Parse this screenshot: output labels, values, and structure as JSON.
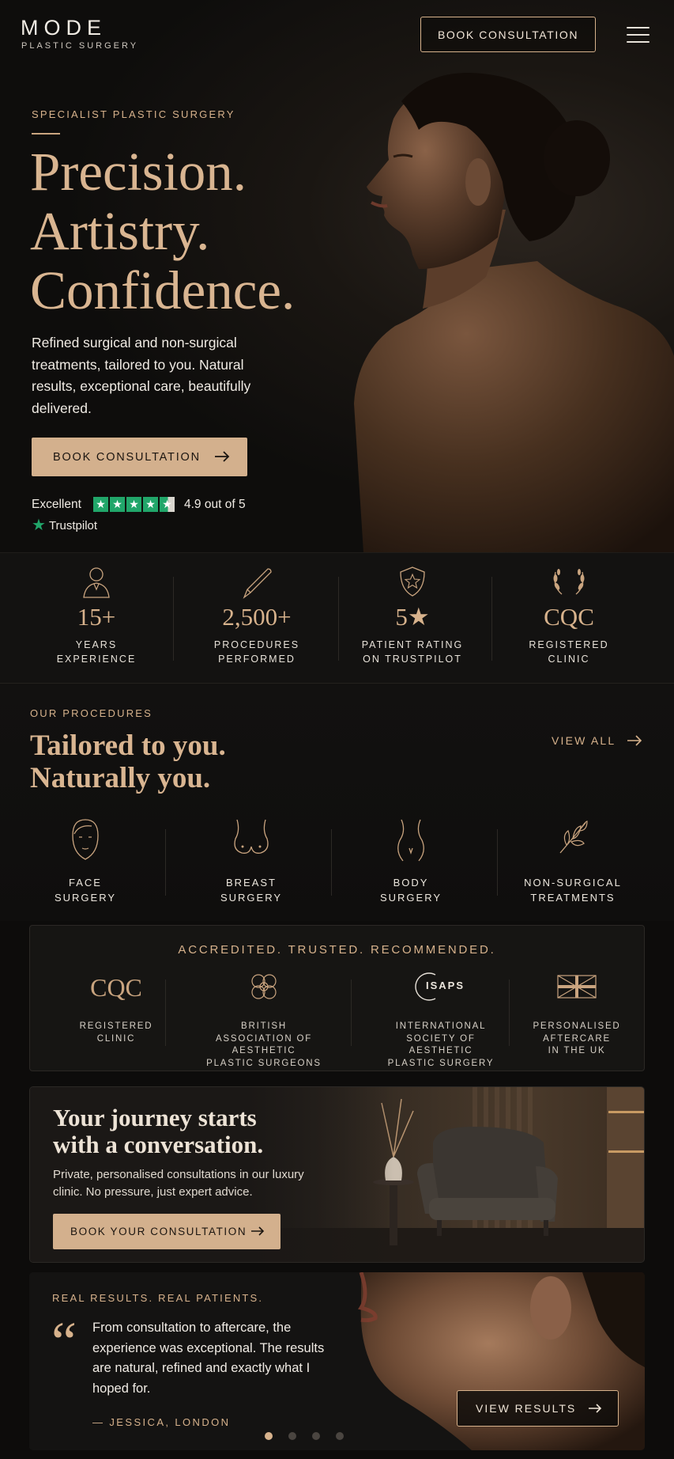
{
  "header": {
    "logo": "MODE",
    "logo_sub": "PLASTIC SURGERY",
    "cta": "BOOK CONSULTATION"
  },
  "hero": {
    "eyebrow": "SPECIALIST PLASTIC SURGERY",
    "title_lines": [
      "Precision.",
      "Artistry.",
      "Confidence."
    ],
    "description": "Refined surgical and non-surgical treatments, tailored to you. Natural results, exceptional care, beautifully delivered.",
    "cta": "BOOK CONSULTATION",
    "trustpilot": {
      "label": "Excellent",
      "rating": 4.9,
      "score_text": "4.9 out of 5",
      "brand": "Trustpilot",
      "brand_color": "#21a66a"
    }
  },
  "stats": [
    {
      "icon": "person-icon",
      "value": "15+",
      "label_lines": [
        "YEARS",
        "EXPERIENCE"
      ]
    },
    {
      "icon": "scalpel-icon",
      "value": "2,500+",
      "label_lines": [
        "PROCEDURES",
        "PERFORMED"
      ]
    },
    {
      "icon": "shield-star-icon",
      "value": "5★",
      "label_lines": [
        "PATIENT RATING",
        "ON TRUSTPILOT"
      ]
    },
    {
      "icon": "laurel-icon",
      "value": "CQC",
      "label_lines": [
        "REGISTERED",
        "CLINIC"
      ]
    }
  ],
  "procedures": {
    "eyebrow": "OUR PROCEDURES",
    "title_lines": [
      "Tailored to you.",
      "Naturally you."
    ],
    "view_all": "VIEW ALL",
    "items": [
      {
        "icon": "face-icon",
        "label_lines": [
          "FACE",
          "SURGERY"
        ]
      },
      {
        "icon": "breast-icon",
        "label_lines": [
          "BREAST",
          "SURGERY"
        ]
      },
      {
        "icon": "body-icon",
        "label_lines": [
          "BODY",
          "SURGERY"
        ]
      },
      {
        "icon": "leaf-icon",
        "label_lines": [
          "NON-SURGICAL",
          "TREATMENTS"
        ]
      }
    ]
  },
  "accreditations": {
    "title": "ACCREDITED. TRUSTED. RECOMMENDED.",
    "items": [
      {
        "icon": "cqc-logo",
        "logo_text": "CQC",
        "label_lines": [
          "REGISTERED",
          "CLINIC"
        ]
      },
      {
        "icon": "baaps-crest-icon",
        "label_lines": [
          "BRITISH",
          "ASSOCIATION OF",
          "AESTHETIC",
          "PLASTIC SURGEONS"
        ]
      },
      {
        "icon": "isaps-logo",
        "logo_text": "ISAPS",
        "label_lines": [
          "INTERNATIONAL",
          "SOCIETY OF",
          "AESTHETIC",
          "PLASTIC SURGERY"
        ]
      },
      {
        "icon": "uk-flag-icon",
        "label_lines": [
          "PERSONALISED",
          "AFTERCARE",
          "IN THE UK"
        ]
      }
    ]
  },
  "consultation": {
    "title_lines": [
      "Your journey starts",
      "with a conversation."
    ],
    "description": "Private, personalised consultations in our luxury clinic. No pressure, just expert advice.",
    "cta": "BOOK YOUR CONSULTATION"
  },
  "testimonial": {
    "eyebrow": "REAL RESULTS. REAL PATIENTS.",
    "quote": "From consultation to aftercare, the experience was exceptional. The results are natural, refined and exactly what I hoped for.",
    "author": "— JESSICA, LONDON",
    "cta": "VIEW RESULTS",
    "carousel_total": 4,
    "carousel_active": 1
  },
  "colors": {
    "accent": "#d7b28c",
    "background": "#0d0c0b",
    "button_fill": "#d3b08d"
  }
}
